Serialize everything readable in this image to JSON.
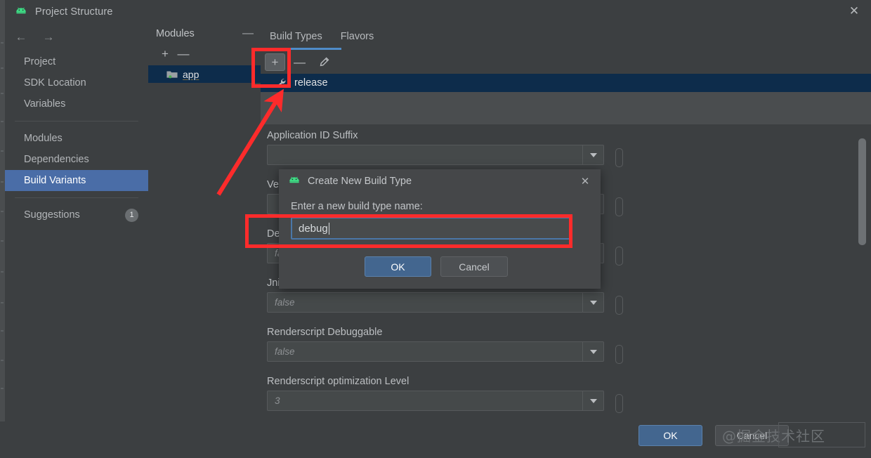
{
  "window": {
    "title": "Project Structure",
    "logo_icon": "android-head-icon",
    "close_icon": "close-icon"
  },
  "nav": {
    "back_icon": "arrow-left-icon",
    "forward_icon": "arrow-right-icon",
    "items": [
      {
        "label": "Project",
        "selected": false
      },
      {
        "label": "SDK Location",
        "selected": false
      },
      {
        "label": "Variables",
        "selected": false
      },
      {
        "label": "Modules",
        "selected": false
      },
      {
        "label": "Dependencies",
        "selected": false
      },
      {
        "label": "Build Variants",
        "selected": true
      },
      {
        "label": "Suggestions",
        "selected": false,
        "badge": "1"
      }
    ]
  },
  "modules": {
    "header": "Modules",
    "collapse_icon": "minus-icon",
    "add_icon": "plus-icon",
    "remove_icon": "minus-icon",
    "rows": [
      {
        "name": "app",
        "icon": "module-folder-icon"
      }
    ]
  },
  "main": {
    "tabs": [
      {
        "label": "Build Types",
        "active": true
      },
      {
        "label": "Flavors",
        "active": false
      }
    ],
    "toolbar": {
      "add_icon": "plus-icon",
      "remove_icon": "minus-icon",
      "edit_icon": "pencil-icon"
    },
    "build_types": [
      {
        "name": "release",
        "icon": "wrench-icon",
        "selected": true
      }
    ],
    "fields": [
      {
        "label": "Application ID Suffix",
        "value": "",
        "dropdown_icon": "chevron-down-icon"
      },
      {
        "label": "Version Name Suffix",
        "value": "",
        "dropdown_icon": "chevron-down-icon"
      },
      {
        "label": "Debuggable",
        "value": "false",
        "dropdown_icon": "chevron-down-icon"
      },
      {
        "label": "Jni Debuggable",
        "value": "false",
        "dropdown_icon": "chevron-down-icon"
      },
      {
        "label": "Renderscript Debuggable",
        "value": "false",
        "dropdown_icon": "chevron-down-icon"
      },
      {
        "label": "Renderscript optimization Level",
        "value": "3",
        "dropdown_icon": "chevron-down-icon"
      }
    ],
    "scrollbar": "vertical-scrollbar"
  },
  "footer": {
    "ok_label": "OK",
    "cancel_label": "Cancel",
    "watermark": "@掘金技术社区"
  },
  "dialog": {
    "logo_icon": "android-head-icon",
    "title": "Create New Build Type",
    "close_icon": "close-icon",
    "prompt": "Enter a new build type name:",
    "input_value": "debug",
    "ok_label": "OK",
    "cancel_label": "Cancel"
  },
  "annotations": {
    "highlight_color": "#fd2b2b",
    "boxes": [
      {
        "name": "add-build-type-highlight"
      },
      {
        "name": "build-type-name-input-highlight"
      }
    ],
    "arrow": {
      "name": "pointer-arrow-to-add-button"
    }
  },
  "colors": {
    "background": "#3c3f41",
    "panel": "#45494a",
    "selection_blue": "#4a6da7",
    "row_selection": "#0d2c4b",
    "accent_tab": "#4f8cc9",
    "primary_button": "#43668f",
    "annotation_red": "#fd2b2b",
    "android_green": "#3ddc84"
  }
}
